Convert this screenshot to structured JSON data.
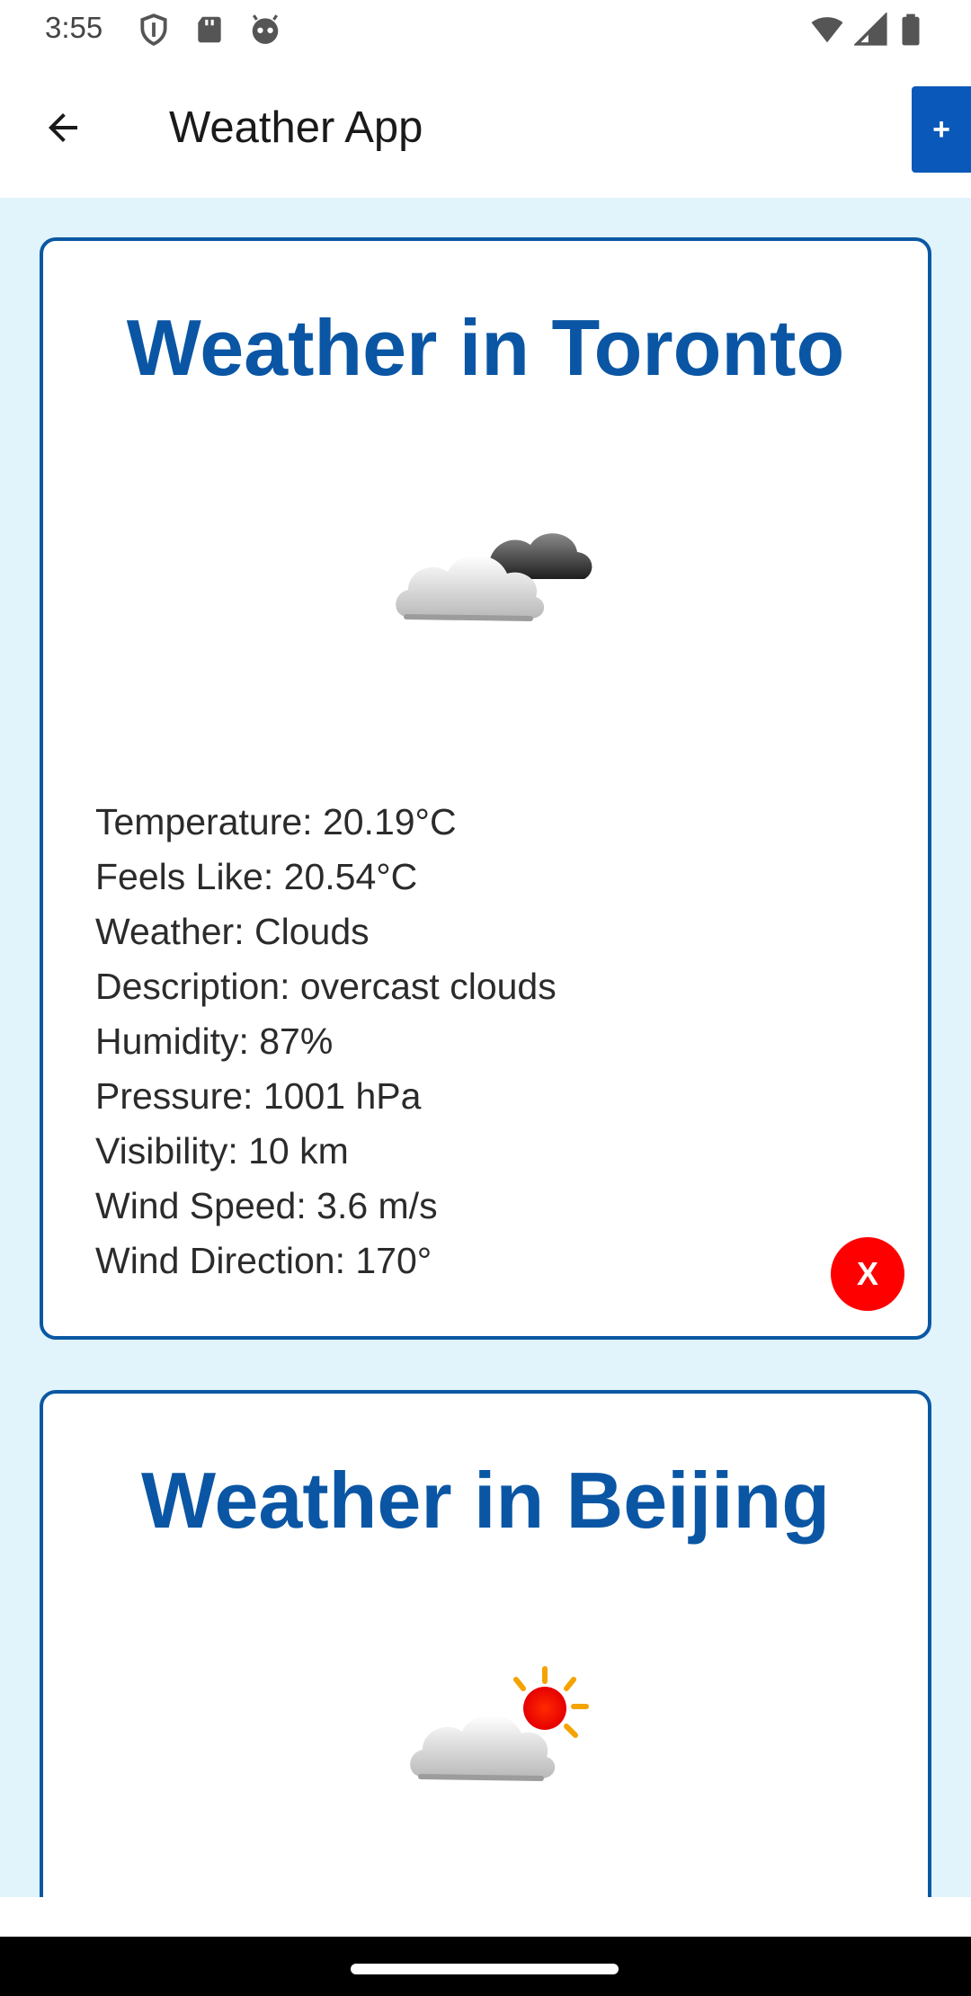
{
  "status_bar": {
    "time": "3:55",
    "icons_left": [
      "shield-icon",
      "sd-card-icon",
      "android-face-icon"
    ],
    "icons_right": [
      "wifi-icon",
      "cell-signal-icon",
      "battery-icon"
    ]
  },
  "app_bar": {
    "back_icon": "arrow-left-icon",
    "title": "Weather App",
    "add_label": "+",
    "accent_color": "#0a58b9"
  },
  "cards": [
    {
      "title": "Weather in Toronto",
      "icon": "overcast-clouds-icon",
      "details": [
        "Temperature: 20.19°C",
        "Feels Like: 20.54°C",
        "Weather: Clouds",
        "Description: overcast clouds",
        "Humidity: 87%",
        "Pressure: 1001 hPa",
        "Visibility: 10 km",
        "Wind Speed: 3.6 m/s",
        "Wind Direction: 170°"
      ],
      "delete_label": "X"
    },
    {
      "title": "Weather in Beijing",
      "icon": "partly-sunny-icon"
    }
  ],
  "colors": {
    "background": "#e1f3fb",
    "card_border": "#0a58a3",
    "title": "#0a56a4",
    "delete": "#ff0000"
  }
}
